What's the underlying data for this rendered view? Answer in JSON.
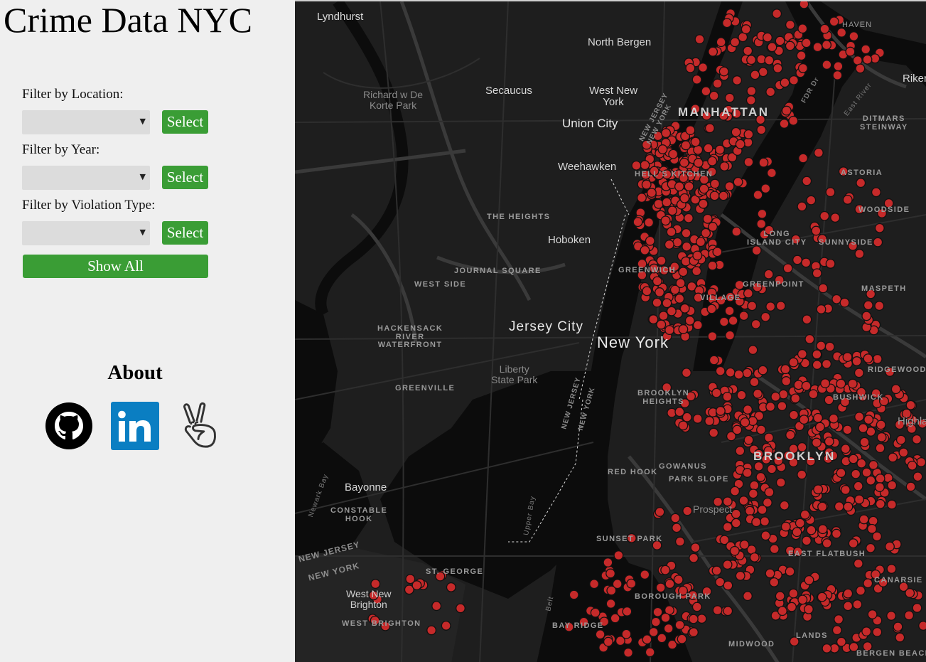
{
  "app": {
    "title": "Crime Data NYC"
  },
  "filters": [
    {
      "label": "Filter by Location:",
      "value": "",
      "button": "Select"
    },
    {
      "label": "Filter by Year:",
      "value": "",
      "button": "Select"
    },
    {
      "label": "Filter by Violation Type:",
      "value": "",
      "button": "Select"
    }
  ],
  "show_all_label": "Show All",
  "about": {
    "title": "About",
    "links": [
      "github-icon",
      "linkedin-icon",
      "angellist-icon"
    ]
  },
  "colors": {
    "accent": "#3a9d35",
    "marker": "#c62a2a",
    "map_bg": "#1b1b1b"
  },
  "map": {
    "labels": {
      "lyndhurst": "Lyndhurst",
      "north_bergen": "North Bergen",
      "secaucus": "Secaucus",
      "west_new_york": "West New\nYork",
      "richard_park": "Richard w De\nKorte Park",
      "union_city": "Union City",
      "weehawken": "Weehawken",
      "manhattan": "MANHATTAN",
      "ditmars": "DITMARS\nSTEINWAY",
      "rikers": "Riker",
      "the_heights": "THE HEIGHTS",
      "hoboken": "Hoboken",
      "astoria": "ASTORIA",
      "woodside": "WOODSIDE",
      "journal_square": "JOURNAL SQUARE",
      "west_side": "WEST SIDE",
      "long_island_city": "LONG\nISLAND CITY",
      "sunnyside": "SUNNYSIDE",
      "greenpoint": "GREENPOINT",
      "maspeth": "MASPETH",
      "hackensack": "HACKENSACK\nRIVER\nWATERFRONT",
      "jersey_city": "Jersey City",
      "new_york": "New York",
      "liberty": "Liberty\nState Park",
      "greenville": "GREENVILLE",
      "ridgewood": "RIDGEWOOD",
      "bushwick": "BUSHWICK",
      "brooklyn_heights": "BROOKLYN\nHEIGHTS",
      "highland": "Highla",
      "brooklyn": "BROOKLYN",
      "gowanus": "GOWANUS",
      "red_hook": "RED HOOK",
      "park_slope": "PARK SLOPE",
      "bayonne": "Bayonne",
      "constable_hook": "CONSTABLE\nHOOK",
      "prospect": "Prospect",
      "sunset_park": "SUNSET PARK",
      "east_flatbush": "EAST FLATBUSH",
      "st_george": "ST. GEORGE",
      "west_new_brighton": "West New\nBrighton",
      "west_brighton": "WEST BRIGHTON",
      "boro_park": "BOROUGH PARK",
      "bay_ridge": "BAY RIDGE",
      "midwood": "MIDWOOD",
      "canarsie": "CANARSIE",
      "bergen_beach": "BERGEN BEACH",
      "lands": "LANDS",
      "hell_kitchen": "HELL'S KITCHEN",
      "greenwich": "GREENWICH",
      "village": "VILLAGE",
      "nj1": "NEW JERSEY",
      "ny1": "NEW YORK",
      "nj2": "NEW JERSEY",
      "ny2": "NEW YORK",
      "nj3": "NEW JERSEY",
      "ny3": "NEW YORK",
      "fdr": "FDR Dr",
      "east_river": "East River",
      "upper_bay": "Upper Bay",
      "newark_bay": "Newark Bay",
      "belt": "Belt",
      "harlem": "HAVEN"
    }
  }
}
